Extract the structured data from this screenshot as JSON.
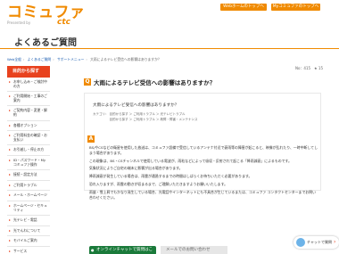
{
  "header": {
    "logo": "コミュファ",
    "logo_sub": "Presented by",
    "logo_ctc": "ctc",
    "btn_web_top": "Webホームのトップへ",
    "btn_my": "Myコミュファのトップへ"
  },
  "page_title": "よくあるご質問",
  "breadcrumb": [
    "Web全般",
    "よくあるご質問",
    "サポートメニュー",
    "大雨によるテレビ受信への影響はありますか？"
  ],
  "sidebar": {
    "title": "目的から探す",
    "items": [
      "お申し込み・ご検討中の方",
      "ご利用開始・工事のご案内",
      "ご契約内容・変更・解約",
      "各種オプション",
      "ご利用料金の確認・お支払い",
      "お引越し・停止の方",
      "ID・パスワード・Myコミュファ操作",
      "接続・設定方法",
      "ご利用トラブル",
      "メール・ホームページ",
      "ホームページ・セキュリティ",
      "光テレビ・電話",
      "光でんわについて",
      "モバイルご案内",
      "サービス"
    ]
  },
  "question": {
    "meta": "No：415　★ 15",
    "badge": "Q",
    "title": "大雨によるテレビ受信への影響はありますか？",
    "text": "大雨によるテレビ受信への影響はありますか？",
    "tags": [
      "カテゴリ：  目的から探す ＞ ご利用トラブル ＞ 光テレビトラブル",
      "　　　　　 目的から探す ＞ ご利用トラブル ＞ 故障・障害・メンテナンス"
    ]
  },
  "answer": {
    "badge": "A",
    "paragraphs": [
      "BS/やCSなどの衛星を使用した放送は、コミュファ設備で受信しているアンテナ付近で豪雨等の障害が起こると、映像が乱れたり、一時中断してしまう場合があります。",
      "この現象は、BS・CSチャンネルで使用している電波が、雨粒などによって吸収・反射されて起こる「降雨減衰」によるものです。",
      "気象状況によりご自宅の端末に影響が出る場合があります。",
      "降雨減衰が発生している場合は、雨雲が通過するまでの時間はしばらくお待ちいただく必要があります。",
      "恐れ入りますが、雨雲の動きが収まるまで、ご理解いただきますようお願いいたします。",
      "雨量・雪上昇でもかなり発生している場合、光電話やインターネットにも不具合が生じているまたは、コミュファ コンタクトセンターまでお問い合わせください。"
    ]
  },
  "bottom": {
    "chat": "オンラインチャットで質問はこちらをクリック",
    "support": "メールでのお問い合わせ"
  },
  "float_chat": {
    "label": "チャットで質問",
    "arrow": "›"
  }
}
